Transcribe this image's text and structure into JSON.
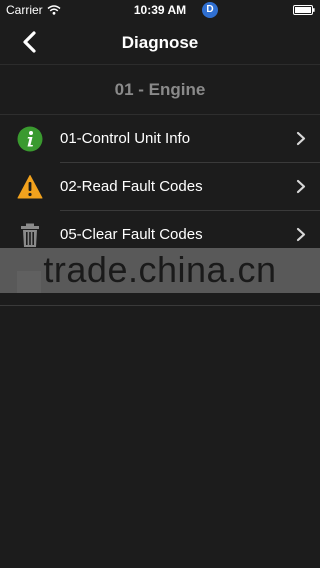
{
  "status_bar": {
    "carrier": "Carrier",
    "time": "10:39 AM",
    "badge": "D"
  },
  "nav": {
    "title": "Diagnose",
    "back_icon": "chevron-left-icon"
  },
  "section": {
    "title": "01 - Engine"
  },
  "items": [
    {
      "label": "01-Control Unit Info",
      "icon": "info-icon",
      "icon_color": "#3a9a2f"
    },
    {
      "label": "02-Read Fault Codes",
      "icon": "warning-icon",
      "icon_color": "#f2a21d"
    },
    {
      "label": "05-Clear Fault Codes",
      "icon": "trash-icon",
      "icon_color": "#8a8a8a"
    }
  ],
  "watermark": {
    "text": "trade.china.cn"
  },
  "colors": {
    "background": "#1c1c1c",
    "section_text": "#8a8a8a",
    "badge": "#2f6fd1"
  }
}
